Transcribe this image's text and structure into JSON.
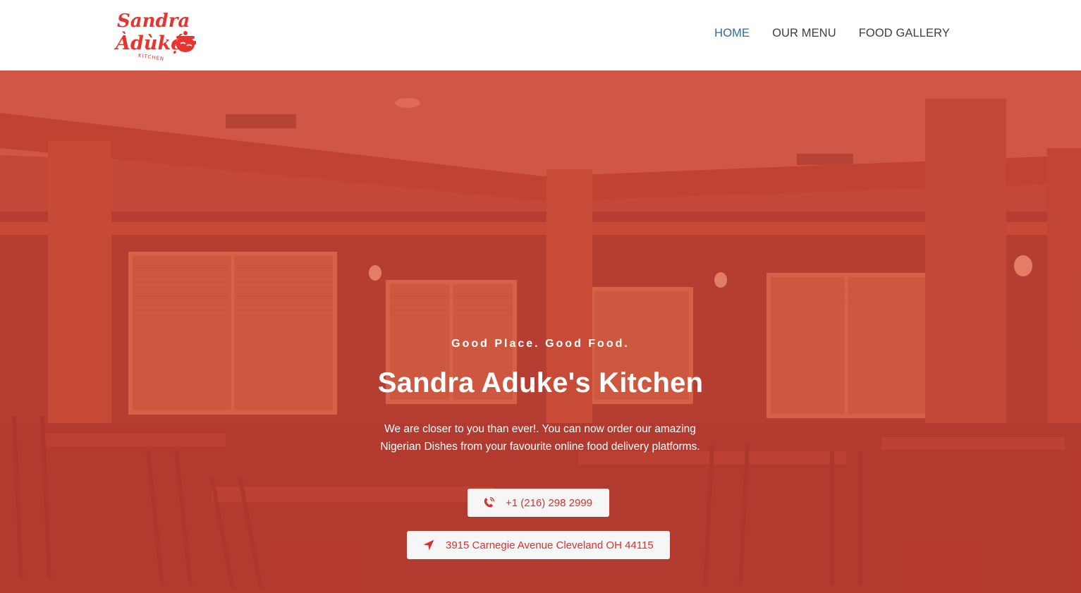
{
  "brand": {
    "logo_line1": "Sandra",
    "logo_line2": "Àdùkẹ́",
    "logo_line3": "KITCHEN",
    "color": "#e8342f"
  },
  "nav": {
    "items": [
      {
        "label": "HOME",
        "active": true
      },
      {
        "label": "OUR MENU",
        "active": false
      },
      {
        "label": "FOOD GALLERY",
        "active": false
      }
    ]
  },
  "hero": {
    "tagline": "Good Place. Good Food.",
    "title": "Sandra Aduke's Kitchen",
    "description": "We are closer to you than ever!. You can now order our amazing Nigerian Dishes from your favourite online food delivery platforms.",
    "phone_button": {
      "label": "+1 (216) 298 2999",
      "icon": "phone-icon"
    },
    "address_button": {
      "label": "3915 Carnegie Avenue Cleveland OH 44115",
      "icon": "location-arrow-icon"
    },
    "overlay_color": "#d64034"
  }
}
